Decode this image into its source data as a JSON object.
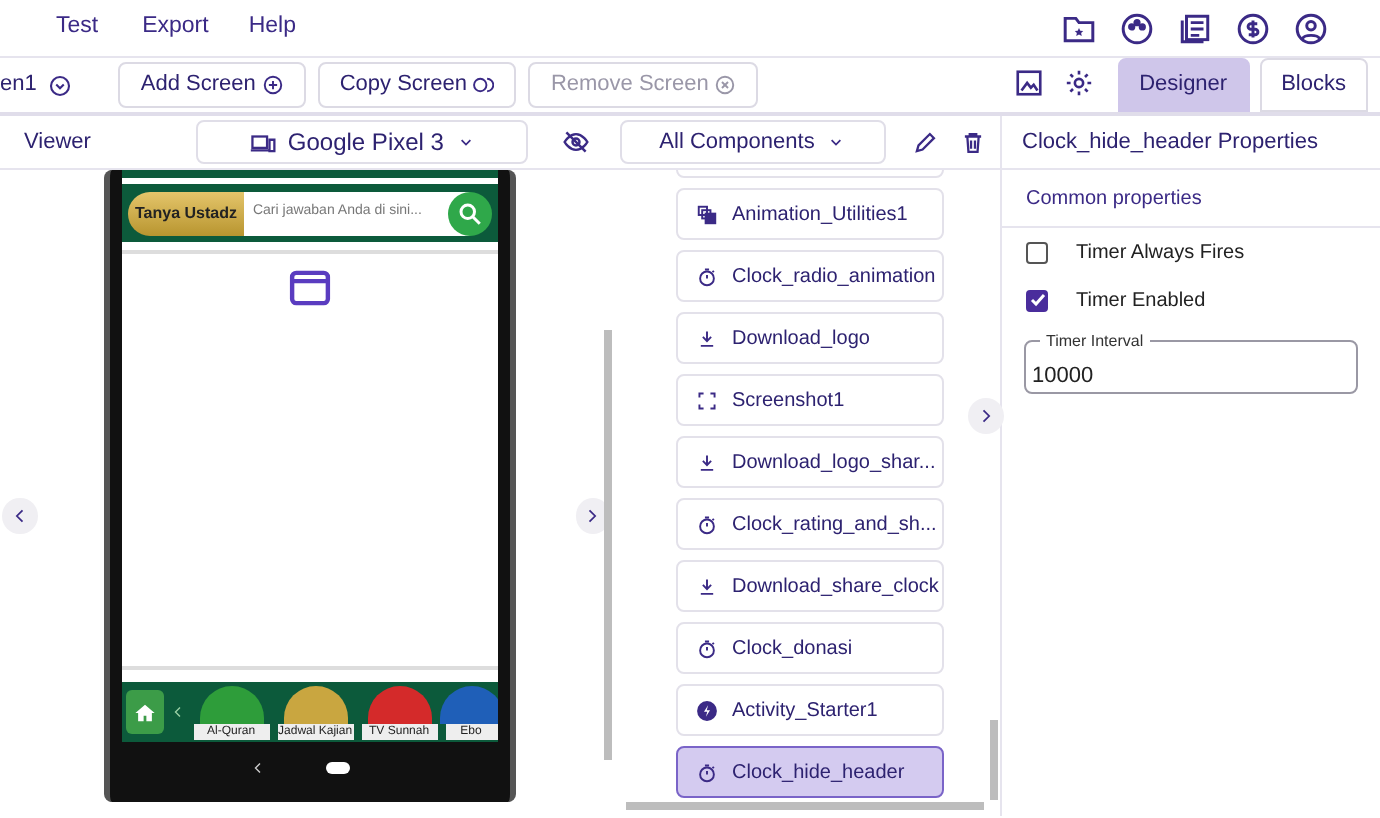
{
  "menu": [
    {
      "label": "Test"
    },
    {
      "label": "Export"
    },
    {
      "label": "Help"
    }
  ],
  "screen_selector": {
    "label": "en1"
  },
  "toolbar_buttons": [
    {
      "label": "Add Screen",
      "kind": "add",
      "disabled": false
    },
    {
      "label": "Copy Screen",
      "kind": "copy",
      "disabled": false
    },
    {
      "label": "Remove Screen",
      "kind": "remove",
      "disabled": true
    }
  ],
  "view_toggle": [
    {
      "label": "Designer",
      "selected": true
    },
    {
      "label": "Blocks",
      "selected": false
    }
  ],
  "viewer": {
    "title": "Viewer",
    "device": "Google Pixel 3",
    "phone": {
      "ask_button": "Tanya Ustadz",
      "search_placeholder": "Cari jawaban Anda di sini...",
      "shortcuts": [
        {
          "label": "Al-Quran",
          "color": "#2e9d3a"
        },
        {
          "label": "Jadwal Kajian",
          "color": "#c9a640"
        },
        {
          "label": "TV Sunnah",
          "color": "#d42a2a"
        },
        {
          "label": "Ebo",
          "color": "#1f5fb8"
        }
      ]
    }
  },
  "components": {
    "filter": "All Components",
    "items": [
      {
        "label": "Animation_Utilities1",
        "kind": "animation",
        "selected": false
      },
      {
        "label": "Clock_radio_animation",
        "kind": "clock",
        "selected": false
      },
      {
        "label": "Download_logo",
        "kind": "download",
        "selected": false
      },
      {
        "label": "Screenshot1",
        "kind": "screenshot",
        "selected": false
      },
      {
        "label": "Download_logo_shar...",
        "kind": "download",
        "selected": false
      },
      {
        "label": "Clock_rating_and_sh...",
        "kind": "clock",
        "selected": false
      },
      {
        "label": "Download_share_clock",
        "kind": "download",
        "selected": false
      },
      {
        "label": "Clock_donasi",
        "kind": "clock",
        "selected": false
      },
      {
        "label": "Activity_Starter1",
        "kind": "activity",
        "selected": false
      },
      {
        "label": "Clock_hide_header",
        "kind": "clock",
        "selected": true
      }
    ]
  },
  "properties": {
    "title": "Clock_hide_header Properties",
    "section": "Common properties",
    "checkboxes": [
      {
        "label": "Timer Always Fires",
        "checked": false
      },
      {
        "label": "Timer Enabled",
        "checked": true
      }
    ],
    "field": {
      "label": "Timer Interval",
      "value": "10000"
    }
  }
}
